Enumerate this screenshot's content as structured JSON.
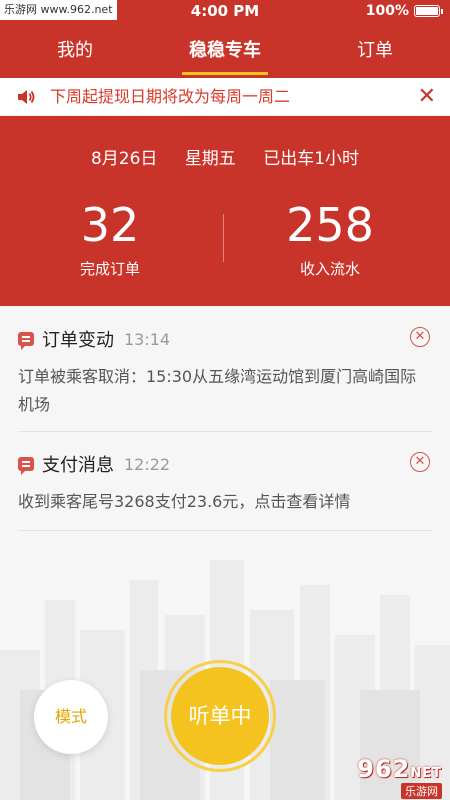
{
  "status_bar": {
    "watermark": "乐游网 www.962.net",
    "time": "4:00 PM",
    "battery": "100%"
  },
  "nav": {
    "tabs": [
      {
        "label": "我的"
      },
      {
        "label": "稳稳专车"
      },
      {
        "label": "订单"
      }
    ],
    "active_index": 1
  },
  "notice": {
    "text": "下周起提现日期将改为每周一周二",
    "close": "✕"
  },
  "summary": {
    "date": "8月26日",
    "weekday": "星期五",
    "duty": "已出车1小时",
    "orders": {
      "value": "32",
      "label": "完成订单"
    },
    "income": {
      "value": "258",
      "label": "收入流水"
    }
  },
  "messages": [
    {
      "title": "订单变动",
      "time": "13:14",
      "body": "订单被乘客取消：15:30从五缘湾运动馆到厦门高崎国际机场"
    },
    {
      "title": "支付消息",
      "time": "12:22",
      "body": "收到乘客尾号3268支付23.6元，点击查看详情"
    }
  ],
  "controls": {
    "mode_label": "模式",
    "listen_label": "听单中"
  },
  "brand_logo": {
    "number": "962",
    "suffix": "NET",
    "name": "乐游网"
  },
  "colors": {
    "primary": "#c8342a",
    "accent": "#f5c320",
    "mode_text": "#e5a400"
  }
}
